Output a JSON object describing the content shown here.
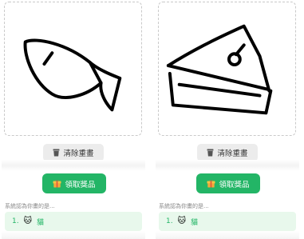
{
  "panels": [
    {
      "drawing": "fish",
      "clear_label": "清除重畫",
      "prize_label": "領取獎品",
      "guess_label": "系統認為你畫的是...",
      "guess_rank": "1.",
      "guess_icon": "🐱",
      "guess_text": "貓"
    },
    {
      "drawing": "cake",
      "clear_label": "清除重畫",
      "prize_label": "領取獎品",
      "guess_label": "系統認為你畫的是...",
      "guess_rank": "1.",
      "guess_icon": "🐱",
      "guess_text": "貓"
    }
  ],
  "colors": {
    "accent": "#23b566",
    "guess_bg": "#e8f8ec",
    "clear_bg": "#ececec",
    "stroke": "#000000"
  },
  "icons": {
    "clear": "trash-icon",
    "prize": "gift-icon",
    "guess": "cat-face-icon"
  }
}
